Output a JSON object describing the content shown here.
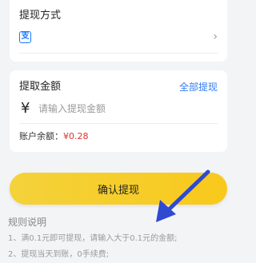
{
  "method_section": {
    "title": "提现方式",
    "selected_method_icon": "alipay-icon",
    "chevron_icon": "chevron-right-icon"
  },
  "amount_section": {
    "title": "提取金额",
    "withdraw_all_label": "全部提现",
    "currency_symbol": "¥",
    "amount_placeholder": "请输入提现金额",
    "balance_label": "账户余额：",
    "balance_value": "¥0.28"
  },
  "confirm_button_label": "确认提现",
  "rules": {
    "title": "规则说明",
    "items": [
      "1、满0.1元即可提现，请输入大于0.1元的金额;",
      "2、提现当天到账，0手续费;"
    ]
  },
  "colors": {
    "accent_blue": "#2f7cf6",
    "button_yellow": "#f8c91c",
    "balance_red": "#d9372f",
    "annotation_arrow": "#2f49d1"
  }
}
